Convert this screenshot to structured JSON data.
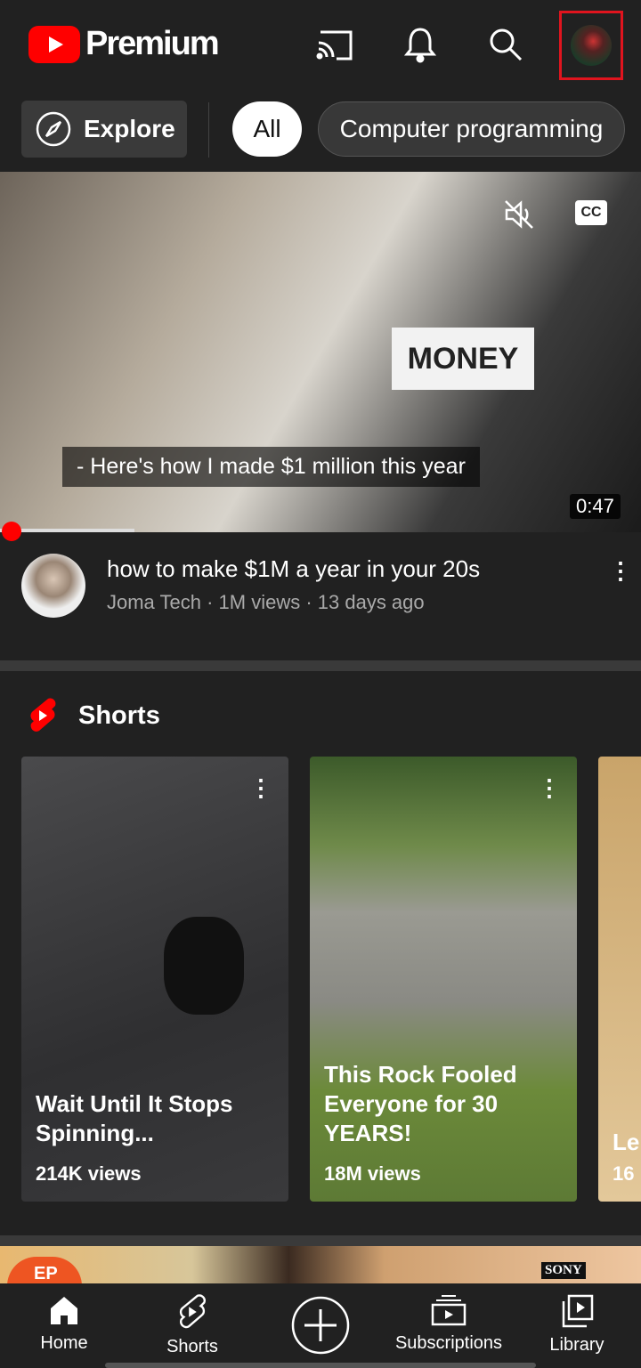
{
  "header": {
    "brand": "Premium",
    "icons": [
      "cast-icon",
      "bell-icon",
      "search-icon",
      "avatar"
    ]
  },
  "chips": {
    "explore": "Explore",
    "items": [
      "All",
      "Computer programming"
    ]
  },
  "featured": {
    "caption": "- Here's how I made $1 million this year",
    "duration": "0:47",
    "progress_percent": 21,
    "title": "how to make $1M a year in your 20s",
    "meta": "Joma Tech · 1M views · 13 days ago",
    "thumb_text": "MONEY"
  },
  "shorts": {
    "heading": "Shorts",
    "items": [
      {
        "title": "Wait Until It Stops Spinning...",
        "views": "214K views"
      },
      {
        "title": "This Rock Fooled Everyone for 30 YEARS!",
        "views": "18M views"
      },
      {
        "title": "Le",
        "views": "16"
      }
    ]
  },
  "next": {
    "badge": "EP",
    "brand": "SONY"
  },
  "nav": [
    {
      "label": "Home"
    },
    {
      "label": "Shorts"
    },
    {
      "label": ""
    },
    {
      "label": "Subscriptions"
    },
    {
      "label": "Library"
    }
  ],
  "colors": {
    "accent": "#ff0000",
    "bg": "#212121"
  }
}
